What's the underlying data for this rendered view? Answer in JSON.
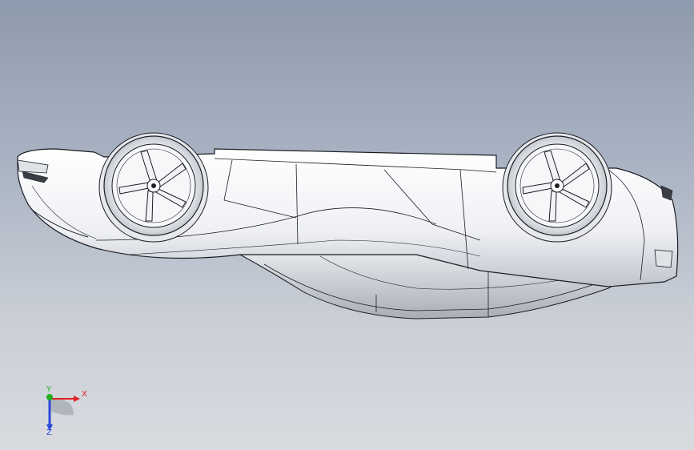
{
  "viewport": {
    "background_top": "#8e9aad",
    "background_bottom": "#d9dbe0"
  },
  "model": {
    "body_color": "#f3f4f7",
    "shade_color": "#c9ccd3",
    "edge_color": "#1b1d22"
  },
  "triad": {
    "x_label": "X",
    "y_label": "Y",
    "z_label": "Z",
    "x_color": "#e02020",
    "y_color": "#20b020",
    "z_color": "#2a48d8"
  }
}
